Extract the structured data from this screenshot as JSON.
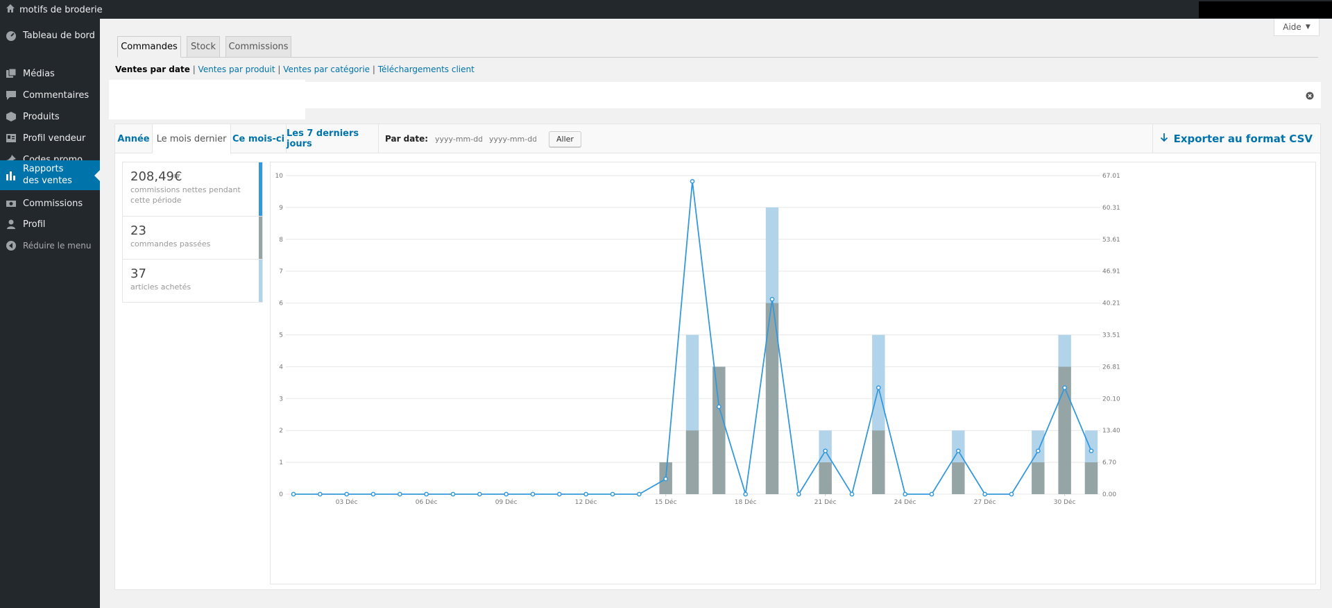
{
  "adminbar": {
    "site_name": "motifs de broderie"
  },
  "sidebar": {
    "items": [
      {
        "label": "Tableau de bord",
        "icon": "dashboard-icon"
      },
      {
        "label": "Médias",
        "icon": "media-icon"
      },
      {
        "label": "Commentaires",
        "icon": "comments-icon"
      },
      {
        "label": "Produits",
        "icon": "products-icon"
      },
      {
        "label": "Profil vendeur",
        "icon": "vendor-profile-icon"
      },
      {
        "label": "Codes promo",
        "icon": "pin-icon"
      },
      {
        "label": "Rapports des ventes",
        "icon": "bar-chart-icon",
        "active": true
      },
      {
        "label": "Commissions",
        "icon": "money-icon"
      },
      {
        "label": "Profil",
        "icon": "user-icon"
      },
      {
        "label": "Réduire le menu",
        "icon": "collapse-icon"
      }
    ]
  },
  "help": {
    "label": "Aide"
  },
  "tabs": [
    "Commandes",
    "Stock",
    "Commissions"
  ],
  "subnav": {
    "current": "Ventes par date",
    "links": [
      "Ventes par produit",
      "Ventes par catégorie",
      "Téléchargements client"
    ]
  },
  "range": {
    "tabs": [
      "Année",
      "Le mois dernier",
      "Ce mois-ci",
      "Les 7 derniers jours"
    ],
    "active": "Le mois dernier",
    "by_date_label": "Par date:",
    "start_placeholder": "yyyy-mm-dd",
    "end_placeholder": "yyyy-mm-dd",
    "go_label": "Aller",
    "export_label": "Exporter au format CSV"
  },
  "legend": [
    {
      "value": "208,49€",
      "label": "commissions nettes pendant cette période",
      "color": "#3498db"
    },
    {
      "value": "23",
      "label": "commandes passées",
      "color": "#95a5a6"
    },
    {
      "value": "37",
      "label": "articles achetés",
      "color": "#b1d4ea"
    }
  ],
  "colors": {
    "accent": "#0073aa",
    "line": "#3498db",
    "bar_items": "#b1d4ea",
    "bar_orders": "#95a5a6"
  },
  "chart_data": {
    "type": "bar",
    "days": [
      "01",
      "02",
      "03",
      "04",
      "05",
      "06",
      "07",
      "08",
      "09",
      "10",
      "11",
      "12",
      "13",
      "14",
      "15",
      "16",
      "17",
      "18",
      "19",
      "20",
      "21",
      "22",
      "23",
      "24",
      "25",
      "26",
      "27",
      "28",
      "29",
      "30",
      "31"
    ],
    "x_tick_labels": [
      "03 Déc",
      "06 Déc",
      "09 Déc",
      "12 Déc",
      "15 Déc",
      "18 Déc",
      "21 Déc",
      "24 Déc",
      "27 Déc",
      "30 Déc"
    ],
    "x_tick_days": [
      3,
      6,
      9,
      12,
      15,
      18,
      21,
      24,
      27,
      30
    ],
    "y_left_ticks": [
      "0",
      "1",
      "2",
      "3",
      "4",
      "5",
      "6",
      "7",
      "8",
      "9",
      "10"
    ],
    "y_right_ticks": [
      "0.00",
      "6.70",
      "13.40",
      "20.10",
      "26.81",
      "33.51",
      "40.21",
      "46.91",
      "53.61",
      "60.31",
      "67.01"
    ],
    "ylim_left": [
      0,
      10
    ],
    "ylim_right": [
      0,
      67.01
    ],
    "series": [
      {
        "name": "articles achetés",
        "values": [
          0,
          0,
          0,
          0,
          0,
          0,
          0,
          0,
          0,
          0,
          0,
          0,
          0,
          0,
          1,
          5,
          4,
          0,
          9,
          0,
          2,
          0,
          5,
          0,
          0,
          2,
          0,
          0,
          2,
          5,
          2
        ]
      },
      {
        "name": "commandes passées",
        "values": [
          0,
          0,
          0,
          0,
          0,
          0,
          0,
          0,
          0,
          0,
          0,
          0,
          0,
          0,
          1,
          2,
          4,
          0,
          6,
          0,
          1,
          0,
          2,
          0,
          0,
          1,
          0,
          0,
          1,
          4,
          1
        ]
      },
      {
        "name": "commissions nettes pendant cette période",
        "values": [
          0,
          0,
          0,
          0,
          0,
          0,
          0,
          0,
          0,
          0,
          0,
          0,
          0,
          0,
          3.2,
          65.8,
          18.4,
          0,
          41.0,
          0,
          9.1,
          0,
          22.4,
          0,
          0,
          9.1,
          0,
          0,
          9.1,
          22.4,
          9.1
        ]
      }
    ]
  }
}
